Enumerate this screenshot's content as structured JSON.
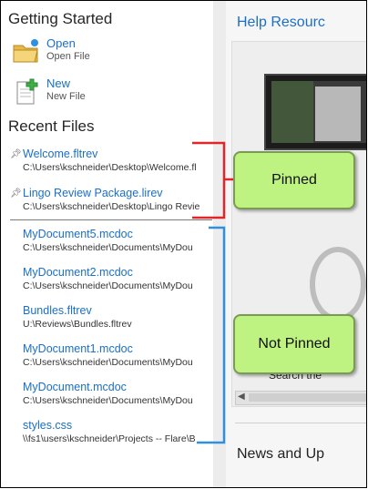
{
  "getting_started": {
    "title": "Getting Started",
    "open": {
      "label": "Open",
      "sub": "Open File"
    },
    "new": {
      "label": "New",
      "sub": "New File"
    }
  },
  "recent": {
    "title": "Recent Files",
    "pinned": [
      {
        "name": "Welcome.fltrev",
        "path": "C:\\Users\\kschneider\\Desktop\\Welcome.fl"
      },
      {
        "name": "Lingo Review Package.lirev",
        "path": "C:\\Users\\kschneider\\Desktop\\Lingo Revie"
      }
    ],
    "not_pinned": [
      {
        "name": "MyDocument5.mcdoc",
        "path": "C:\\Users\\kschneider\\Documents\\MyDou"
      },
      {
        "name": "MyDocument2.mcdoc",
        "path": "C:\\Users\\kschneider\\Documents\\MyDou"
      },
      {
        "name": "Bundles.fltrev",
        "path": "U:\\Reviews\\Bundles.fltrev"
      },
      {
        "name": "MyDocument1.mcdoc",
        "path": "C:\\Users\\kschneider\\Documents\\MyDou"
      },
      {
        "name": "MyDocument.mcdoc",
        "path": "C:\\Users\\kschneider\\Documents\\MyDou"
      },
      {
        "name": "styles.css",
        "path": "\\\\fs1\\users\\kschneider\\Projects -- Flare\\B"
      }
    ]
  },
  "help": {
    "title": "Help Resourc",
    "search_text": "Search the",
    "news_title": "News and Up"
  },
  "callouts": {
    "pinned": "Pinned",
    "not_pinned": "Not Pinned"
  },
  "colors": {
    "link": "#1b6fc7",
    "bracket_pinned": "#e0262a",
    "bracket_not_pinned": "#2f8fe0",
    "callout_fill": "#bef281"
  }
}
